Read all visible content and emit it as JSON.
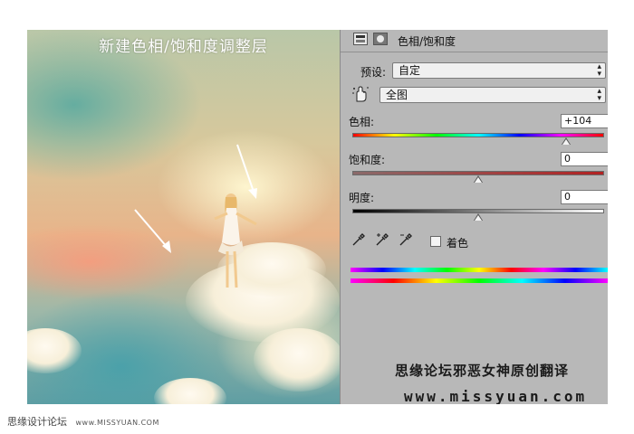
{
  "photo": {
    "caption": "新建色相/饱和度调整层"
  },
  "panel": {
    "title": "色相/饱和度",
    "preset_label": "预设:",
    "preset_value": "自定",
    "channel_value": "全图",
    "hue_label": "色相:",
    "hue_value": "+104",
    "saturation_label": "饱和度:",
    "saturation_value": "0",
    "lightness_label": "明度:",
    "lightness_value": "0",
    "colorize_label": "着色",
    "colorize_checked": false,
    "watermark_text": "思缘论坛邪恶女神原创翻译",
    "watermark_url": "www.missyuan.com"
  },
  "footer": {
    "site_name": "思缘设计论坛",
    "site_url": "www.MISSYUAN.COM"
  },
  "controls": {
    "hue_position": 0.85,
    "saturation_position": 0.5,
    "lightness_position": 0.5
  },
  "icons": {
    "panel_icons": [
      "adjustment-layer-icon",
      "mask-icon"
    ],
    "target_adjust_tool": "hand-icon",
    "eyedroppers": [
      "eyedropper-icon",
      "eyedropper-plus-icon",
      "eyedropper-minus-icon"
    ]
  },
  "colors": {
    "panel_bg": "#b8b8b8",
    "saturation_track": "#b22222"
  }
}
